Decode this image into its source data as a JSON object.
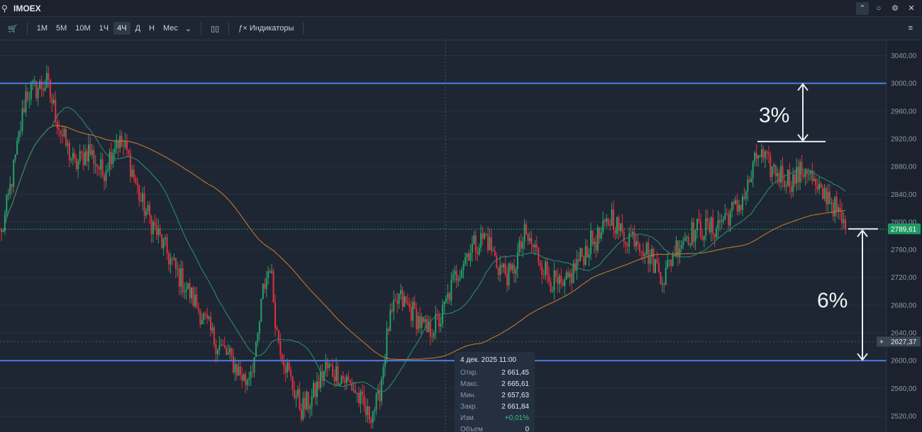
{
  "titlebar": {
    "ticker": "IMOEX",
    "search_icon": "search-icon",
    "collapse_icon": "chevron-up-icon",
    "dock_icon": "circle-icon",
    "settings_icon": "gear-icon",
    "close_icon": "close-icon"
  },
  "toolbar": {
    "chart_type_icon": "cart-icon",
    "timeframes": [
      {
        "label": "1М",
        "active": false
      },
      {
        "label": "5М",
        "active": false
      },
      {
        "label": "10М",
        "active": false
      },
      {
        "label": "1Ч",
        "active": false
      },
      {
        "label": "4Ч",
        "active": true
      },
      {
        "label": "Д",
        "active": false
      },
      {
        "label": "Н",
        "active": false
      },
      {
        "label": "Мес",
        "active": false
      }
    ],
    "dropdown_icon": "chevron-down-icon",
    "candles_icon": "candlestick-icon",
    "indicators_icon": "function-icon",
    "indicators_label": "Индикаторы",
    "menu_icon": "list-menu-icon"
  },
  "chart_data": {
    "type": "candlestick",
    "instrument": "IMOEX",
    "timeframe": "4Ч",
    "ylim": [
      2497,
      3062
    ],
    "y_ticks": [
      {
        "value": 3040,
        "label": "3040,00"
      },
      {
        "value": 3000,
        "label": "3000,00"
      },
      {
        "value": 2960,
        "label": "2960,00"
      },
      {
        "value": 2920,
        "label": "2920,00"
      },
      {
        "value": 2880,
        "label": "2880,00"
      },
      {
        "value": 2840,
        "label": "2840,00"
      },
      {
        "value": 2800,
        "label": "2800,00"
      },
      {
        "value": 2760,
        "label": "2760,00"
      },
      {
        "value": 2720,
        "label": "2720,00"
      },
      {
        "value": 2680,
        "label": "2680,00"
      },
      {
        "value": 2640,
        "label": "2640,00"
      },
      {
        "value": 2600,
        "label": "2600,00"
      },
      {
        "value": 2560,
        "label": "2560,00"
      },
      {
        "value": 2520,
        "label": "2520,00"
      }
    ],
    "price_path": [
      {
        "i": 0,
        "p": 2780
      },
      {
        "i": 8,
        "p": 2890
      },
      {
        "i": 14,
        "p": 2985
      },
      {
        "i": 26,
        "p": 3000
      },
      {
        "i": 34,
        "p": 2930
      },
      {
        "i": 42,
        "p": 2880
      },
      {
        "i": 50,
        "p": 2905
      },
      {
        "i": 58,
        "p": 2870
      },
      {
        "i": 66,
        "p": 2920
      },
      {
        "i": 72,
        "p": 2900
      },
      {
        "i": 80,
        "p": 2830
      },
      {
        "i": 90,
        "p": 2780
      },
      {
        "i": 100,
        "p": 2730
      },
      {
        "i": 112,
        "p": 2680
      },
      {
        "i": 122,
        "p": 2630
      },
      {
        "i": 132,
        "p": 2600
      },
      {
        "i": 140,
        "p": 2570
      },
      {
        "i": 146,
        "p": 2610
      },
      {
        "i": 150,
        "p": 2700
      },
      {
        "i": 154,
        "p": 2740
      },
      {
        "i": 158,
        "p": 2640
      },
      {
        "i": 166,
        "p": 2570
      },
      {
        "i": 172,
        "p": 2530
      },
      {
        "i": 178,
        "p": 2545
      },
      {
        "i": 186,
        "p": 2590
      },
      {
        "i": 194,
        "p": 2580
      },
      {
        "i": 202,
        "p": 2560
      },
      {
        "i": 210,
        "p": 2520
      },
      {
        "i": 216,
        "p": 2540
      },
      {
        "i": 222,
        "p": 2650
      },
      {
        "i": 228,
        "p": 2690
      },
      {
        "i": 236,
        "p": 2670
      },
      {
        "i": 244,
        "p": 2640
      },
      {
        "i": 252,
        "p": 2660
      },
      {
        "i": 260,
        "p": 2720
      },
      {
        "i": 268,
        "p": 2760
      },
      {
        "i": 278,
        "p": 2780
      },
      {
        "i": 284,
        "p": 2740
      },
      {
        "i": 292,
        "p": 2720
      },
      {
        "i": 300,
        "p": 2780
      },
      {
        "i": 306,
        "p": 2760
      },
      {
        "i": 314,
        "p": 2720
      },
      {
        "i": 322,
        "p": 2700
      },
      {
        "i": 330,
        "p": 2740
      },
      {
        "i": 338,
        "p": 2770
      },
      {
        "i": 344,
        "p": 2780
      },
      {
        "i": 350,
        "p": 2810
      },
      {
        "i": 356,
        "p": 2780
      },
      {
        "i": 364,
        "p": 2780
      },
      {
        "i": 372,
        "p": 2750
      },
      {
        "i": 380,
        "p": 2720
      },
      {
        "i": 386,
        "p": 2760
      },
      {
        "i": 392,
        "p": 2780
      },
      {
        "i": 400,
        "p": 2790
      },
      {
        "i": 408,
        "p": 2790
      },
      {
        "i": 416,
        "p": 2810
      },
      {
        "i": 422,
        "p": 2820
      },
      {
        "i": 428,
        "p": 2850
      },
      {
        "i": 434,
        "p": 2900
      },
      {
        "i": 440,
        "p": 2880
      },
      {
        "i": 446,
        "p": 2870
      },
      {
        "i": 454,
        "p": 2860
      },
      {
        "i": 462,
        "p": 2880
      },
      {
        "i": 468,
        "p": 2840
      },
      {
        "i": 474,
        "p": 2840
      },
      {
        "i": 480,
        "p": 2810
      },
      {
        "i": 484,
        "p": 2790
      }
    ],
    "total_bars": 485,
    "levels": [
      {
        "name": "upper-level",
        "value": 3000,
        "color": "#4d7fe0"
      },
      {
        "name": "lower-level",
        "value": 2600,
        "color": "#4d7fe0"
      }
    ],
    "current_price": {
      "value": 2789.61,
      "label": "2789,61",
      "color": "#1f9a64"
    },
    "crosshair_price": {
      "value": 2627.37,
      "label": "2627,37"
    },
    "ma_fast": {
      "color": "#2a8a6e"
    },
    "ma_slow": {
      "color": "#c0782d"
    },
    "annotations": [
      {
        "label": "3%",
        "from": 2916,
        "to": 3000
      },
      {
        "label": "6%",
        "from": 2600,
        "to": 2790
      }
    ]
  },
  "tooltip": {
    "date": "4 дек. 2025 11:00",
    "rows": [
      {
        "key": "Откр.",
        "value": "2 661,45",
        "positive": false
      },
      {
        "key": "Макс.",
        "value": "2 665,61",
        "positive": false
      },
      {
        "key": "Мин.",
        "value": "2 657,63",
        "positive": false
      },
      {
        "key": "Закр.",
        "value": "2 661,84",
        "positive": false
      },
      {
        "key": "Изм.",
        "value": "+0,01%",
        "positive": true
      },
      {
        "key": "Объем",
        "value": "0",
        "positive": false
      }
    ]
  },
  "colors": {
    "up": "#26a269",
    "down": "#e0313f",
    "background": "#1e2633",
    "grid": "#263040",
    "axis_text": "#8d99a8"
  }
}
